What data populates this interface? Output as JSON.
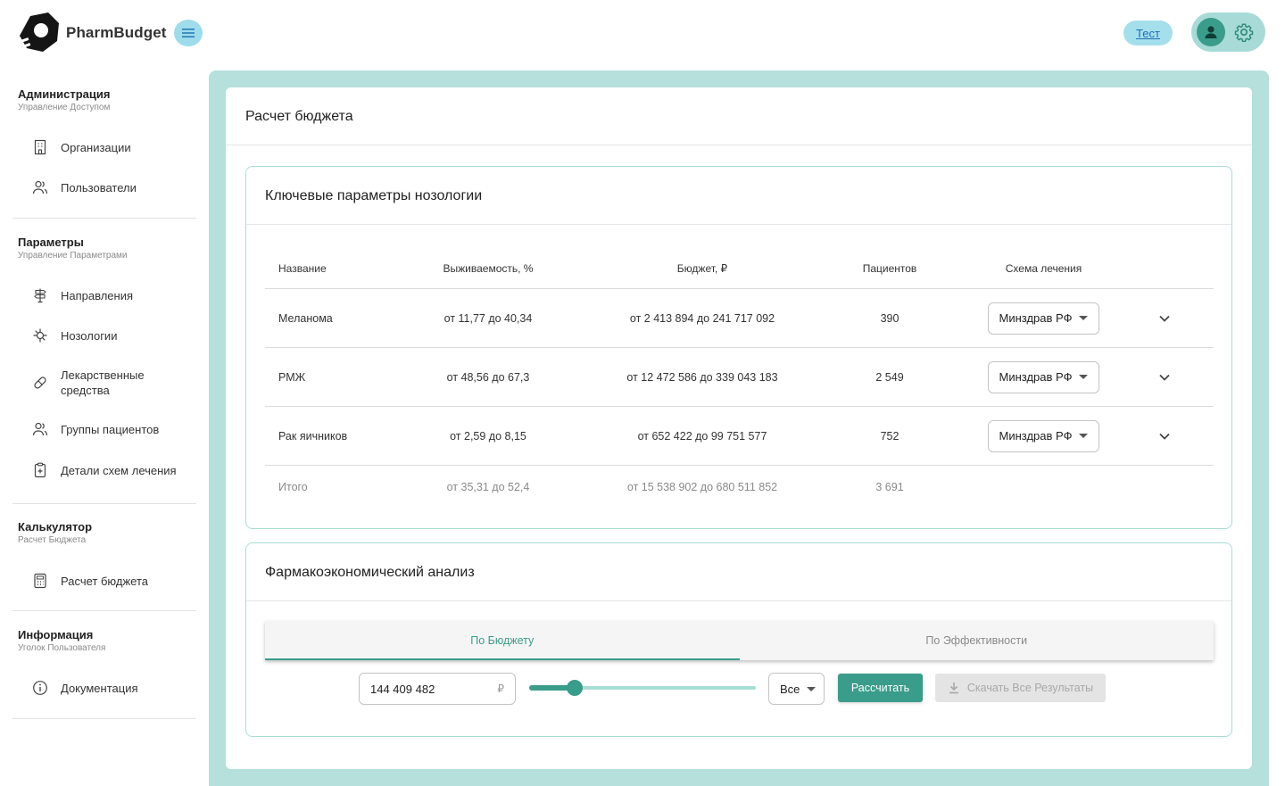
{
  "app": {
    "name": "PharmBudget",
    "test_label": "Тест"
  },
  "sidebar": {
    "sections": [
      {
        "title": "Администрация",
        "subtitle": "Управление Доступом",
        "items": [
          {
            "label": "Организации",
            "icon": "building-icon"
          },
          {
            "label": "Пользователи",
            "icon": "users-icon"
          }
        ]
      },
      {
        "title": "Параметры",
        "subtitle": "Управление Параметрами",
        "items": [
          {
            "label": "Направления",
            "icon": "signpost-icon"
          },
          {
            "label": "Нозологии",
            "icon": "virus-icon"
          },
          {
            "label": "Лекарственные средства",
            "icon": "pill-icon"
          },
          {
            "label": "Группы пациентов",
            "icon": "users-icon"
          },
          {
            "label": "Детали схем лечения",
            "icon": "clipboard-icon"
          }
        ]
      },
      {
        "title": "Калькулятор",
        "subtitle": "Расчет Бюджета",
        "items": [
          {
            "label": "Расчет бюджета",
            "icon": "calculator-icon"
          }
        ]
      },
      {
        "title": "Информация",
        "subtitle": "Уголок Пользователя",
        "items": [
          {
            "label": "Документация",
            "icon": "info-icon"
          }
        ]
      }
    ]
  },
  "page": {
    "title": "Расчет бюджета"
  },
  "nosology": {
    "title": "Ключевые параметры нозологии",
    "columns": [
      "Название",
      "Выживаемость, %",
      "Бюджет, ₽",
      "Пациентов",
      "Схема лечения"
    ],
    "rows": [
      {
        "name": "Меланома",
        "survival": "от 11,77 до 40,34",
        "budget": "от 2 413 894 до 241 717 092",
        "patients": "390",
        "scheme": "Минздрав РФ"
      },
      {
        "name": "РМЖ",
        "survival": "от 48,56 до 67,3",
        "budget": "от 12 472 586 до 339 043 183",
        "patients": "2 549",
        "scheme": "Минздрав РФ"
      },
      {
        "name": "Рак яичников",
        "survival": "от 2,59 до 8,15",
        "budget": "от 652 422 до 99 751 577",
        "patients": "752",
        "scheme": "Минздрав РФ"
      }
    ],
    "total": {
      "name": "Итого",
      "survival": "от 35,31 до 52,4",
      "budget": "от 15 538 902 до 680 511 852",
      "patients": "3 691"
    }
  },
  "analysis": {
    "title": "Фармакоэкономический анализ",
    "tabs": [
      {
        "label": "По Бюджету",
        "active": true
      },
      {
        "label": "По Эффективности",
        "active": false
      }
    ],
    "budget_value": "144 409 482",
    "currency": "₽",
    "slider_fraction": 0.2,
    "filter_value": "Все",
    "calc_label": "Рассчитать",
    "download_label": "Скачать Все Результаты"
  },
  "colors": {
    "accent": "#3a9c8a",
    "panel_bg": "#b5e0dc",
    "menu_btn": "#9edcec"
  }
}
